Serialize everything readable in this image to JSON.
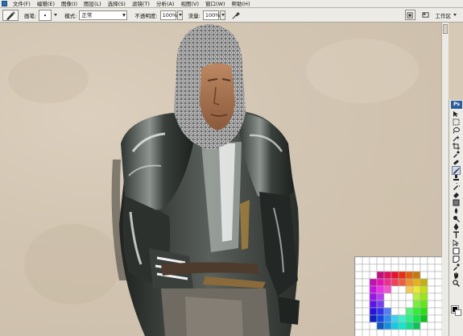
{
  "menu": {
    "items": [
      {
        "label": "文件(F)"
      },
      {
        "label": "编辑(E)"
      },
      {
        "label": "图像(I)"
      },
      {
        "label": "图层(L)"
      },
      {
        "label": "选择(S)"
      },
      {
        "label": "滤镜(T)"
      },
      {
        "label": "分析(A)"
      },
      {
        "label": "视图(V)"
      },
      {
        "label": "窗口(W)"
      },
      {
        "label": "帮助(H)"
      }
    ]
  },
  "options": {
    "brush_label": "画笔:",
    "brush_size": "•",
    "mode_label": "模式:",
    "mode_value": "正常",
    "opacity_label": "不透明度:",
    "opacity_value": "100%",
    "flow_label": "流量:",
    "flow_value": "100%",
    "workspace_label": "工作区"
  },
  "toolbox": {
    "logo": "Ps",
    "foreground_color": "#000000",
    "background_color": "#ffffff"
  },
  "icons": [
    "brush-icon",
    "airbrush-icon",
    "move-icon",
    "marquee-icon",
    "lasso-icon",
    "magic-wand-icon",
    "crop-icon",
    "eyedropper-icon",
    "healing-icon",
    "brush-tool-icon",
    "stamp-icon",
    "history-brush-icon",
    "eraser-icon",
    "gradient-icon",
    "blur-icon",
    "dodge-icon",
    "pen-icon",
    "type-icon",
    "path-select-icon",
    "shape-icon",
    "notes-icon",
    "hand-icon",
    "zoom-icon"
  ]
}
